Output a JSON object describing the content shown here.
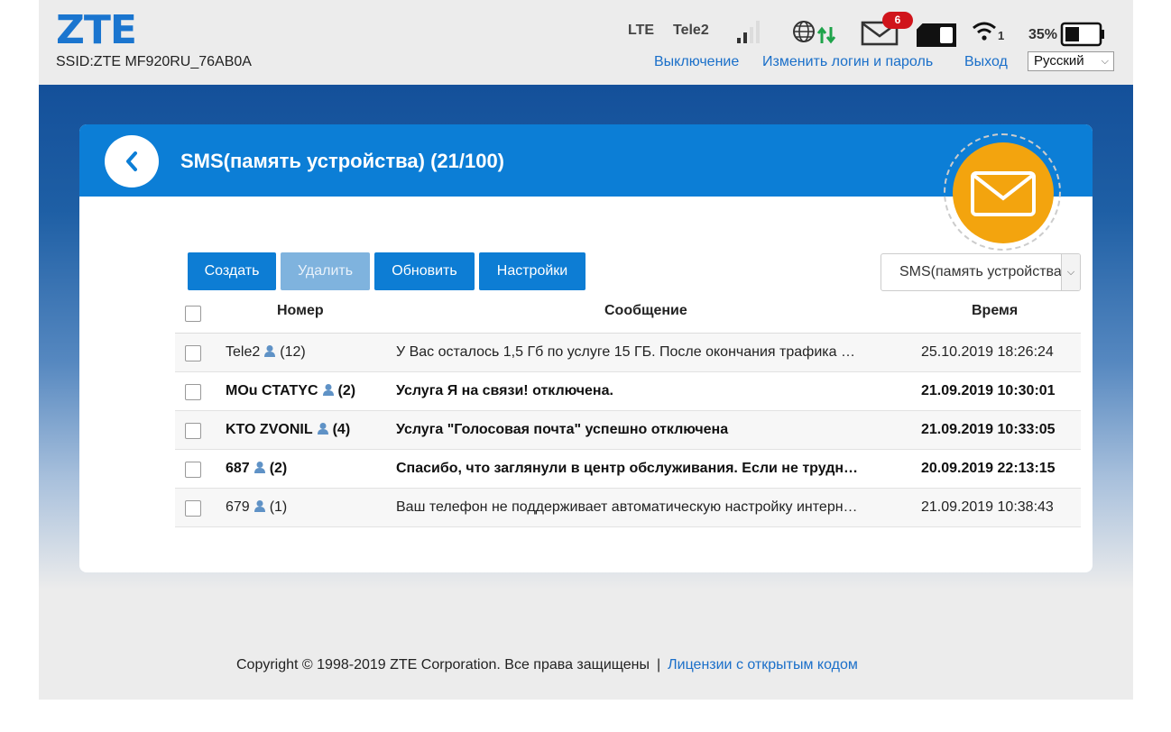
{
  "header": {
    "logo": "ZTE",
    "ssid": "SSID:ZTE MF920RU_76AB0A",
    "network_type": "LTE",
    "carrier": "Tele2",
    "sms_unread_badge": "6",
    "wifi_users": "1",
    "battery_percent": "35%",
    "links": {
      "shutdown": "Выключение",
      "change_credentials": "Изменить логин и пароль",
      "logout": "Выход"
    },
    "language": "Русский"
  },
  "icons": [
    "signal-icon",
    "globe-icon",
    "data-arrows-icon",
    "envelope-icon",
    "sim-icon",
    "wifi-icon",
    "battery-icon",
    "back-icon",
    "large-envelope-icon",
    "person-icon"
  ],
  "colors": {
    "brand": "#1a75cf",
    "header_bar": "#0c7ed6",
    "accent_orange": "#f3a40e",
    "badge_red": "#d0141b",
    "data_green": "#1ea34a"
  },
  "card": {
    "title": "SMS(память устройства) (21/100)"
  },
  "toolbar": {
    "create": "Создать",
    "delete": "Удалить",
    "refresh": "Обновить",
    "settings": "Настройки",
    "storage_select": "SMS(память устройства)"
  },
  "table": {
    "columns": {
      "number": "Номер",
      "message": "Сообщение",
      "time": "Время"
    },
    "rows": [
      {
        "number": "Tele2",
        "count": "(12)",
        "message": "У Вас осталось 1,5 Гб по услуге 15 ГБ. После окончания трафика …",
        "time": "25.10.2019 18:26:24",
        "unread": false
      },
      {
        "number": "MOu CTATYC",
        "count": "(2)",
        "message": "Услуга Я на связи! отключена.",
        "time": "21.09.2019 10:30:01",
        "unread": true
      },
      {
        "number": "KTO ZVONIL",
        "count": "(4)",
        "message": "Услуга \"Голосовая почта\" успешно отключена",
        "time": "21.09.2019 10:33:05",
        "unread": true
      },
      {
        "number": "687",
        "count": "(2)",
        "message": "Спасибо, что заглянули в центр обслуживания. Если не трудн…",
        "time": "20.09.2019 22:13:15",
        "unread": true
      },
      {
        "number": "679",
        "count": "(1)",
        "message": "Ваш телефон не поддерживает автоматическую настройку интерн…",
        "time": "21.09.2019 10:38:43",
        "unread": false
      }
    ]
  },
  "footer": {
    "copyright": "Copyright © 1998-2019 ZTE Corporation. Все права защищены",
    "separator": "|",
    "license_link": "Лицензии с открытым кодом"
  }
}
